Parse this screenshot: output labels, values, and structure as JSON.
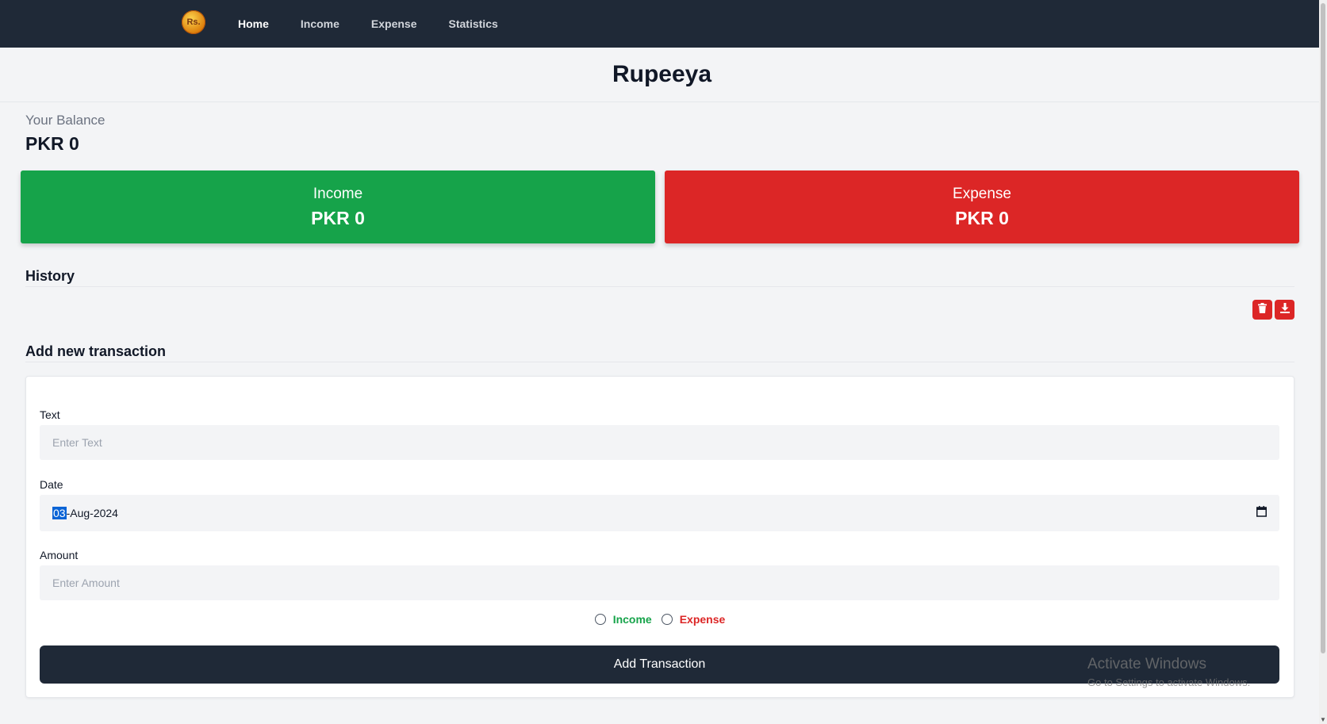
{
  "navbar": {
    "logo_text": "Rs.",
    "links": [
      {
        "label": "Home"
      },
      {
        "label": "Income"
      },
      {
        "label": "Expense"
      },
      {
        "label": "Statistics"
      }
    ]
  },
  "app": {
    "title": "Rupeeya"
  },
  "balance": {
    "label": "Your Balance",
    "value": "PKR 0"
  },
  "cards": {
    "income": {
      "label": "Income",
      "value": "PKR 0"
    },
    "expense": {
      "label": "Expense",
      "value": "PKR 0"
    }
  },
  "history": {
    "title": "History",
    "delete_icon": "trash-icon",
    "download_icon": "download-icon"
  },
  "form": {
    "title": "Add new transaction",
    "text_label": "Text",
    "text_placeholder": "Enter Text",
    "date_label": "Date",
    "date_day": "03",
    "date_rest": "-Aug-2024",
    "amount_label": "Amount",
    "amount_placeholder": "Enter Amount",
    "radio_income": "Income",
    "radio_expense": "Expense",
    "submit_label": "Add Transaction"
  },
  "watermark": {
    "title": "Activate Windows",
    "subtitle": "Go to Settings to activate Windows."
  },
  "colors": {
    "navbar": "#1f2937",
    "income": "#16a34a",
    "expense": "#dc2626",
    "background": "#f3f4f6"
  }
}
